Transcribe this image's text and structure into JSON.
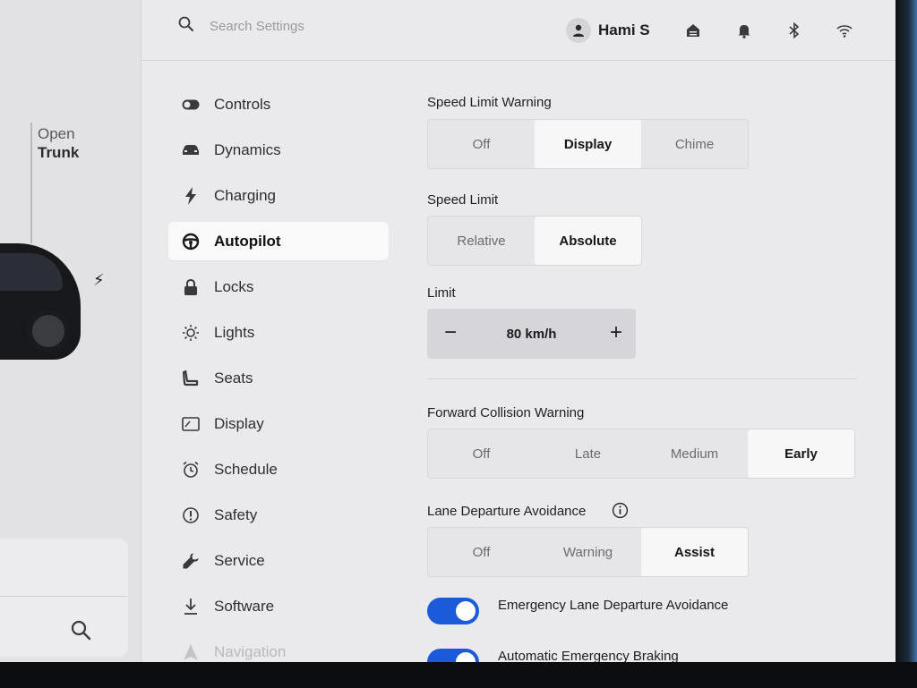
{
  "search": {
    "placeholder": "Search Settings"
  },
  "user": {
    "name": "Hami S"
  },
  "topbar_icons": [
    "home-icon",
    "bell-icon",
    "bluetooth-icon",
    "wifi-icon"
  ],
  "car_pane": {
    "trunk_line1": "Open",
    "trunk_line2": "Trunk"
  },
  "sidebar": {
    "items": [
      {
        "label": "Controls",
        "icon": "toggle-icon"
      },
      {
        "label": "Dynamics",
        "icon": "car-icon"
      },
      {
        "label": "Charging",
        "icon": "bolt-icon"
      },
      {
        "label": "Autopilot",
        "icon": "steering-wheel-icon",
        "active": true
      },
      {
        "label": "Locks",
        "icon": "lock-icon"
      },
      {
        "label": "Lights",
        "icon": "sun-icon"
      },
      {
        "label": "Seats",
        "icon": "seat-icon"
      },
      {
        "label": "Display",
        "icon": "display-icon"
      },
      {
        "label": "Schedule",
        "icon": "alarm-clock-icon"
      },
      {
        "label": "Safety",
        "icon": "alert-circle-icon"
      },
      {
        "label": "Service",
        "icon": "wrench-icon"
      },
      {
        "label": "Software",
        "icon": "download-icon"
      },
      {
        "label": "Navigation",
        "icon": "navigation-icon"
      }
    ]
  },
  "settings": {
    "speed_limit_warning": {
      "label": "Speed Limit Warning",
      "options": [
        "Off",
        "Display",
        "Chime"
      ],
      "selected": "Display"
    },
    "speed_limit": {
      "label": "Speed Limit",
      "options": [
        "Relative",
        "Absolute"
      ],
      "selected": "Absolute"
    },
    "limit": {
      "label": "Limit",
      "value": "80 km/h",
      "minus": "−",
      "plus": "+"
    },
    "forward_collision_warning": {
      "label": "Forward Collision Warning",
      "options": [
        "Off",
        "Late",
        "Medium",
        "Early"
      ],
      "selected": "Early"
    },
    "lane_departure_avoidance": {
      "label": "Lane Departure Avoidance",
      "options": [
        "Off",
        "Warning",
        "Assist"
      ],
      "selected": "Assist"
    },
    "emergency_lane_departure": {
      "label": "Emergency Lane Departure Avoidance",
      "on": true
    },
    "automatic_emergency_braking": {
      "label": "Automatic Emergency Braking",
      "on": true
    }
  },
  "colors": {
    "accent": "#1b5ad8",
    "background": "#eaeaec"
  }
}
